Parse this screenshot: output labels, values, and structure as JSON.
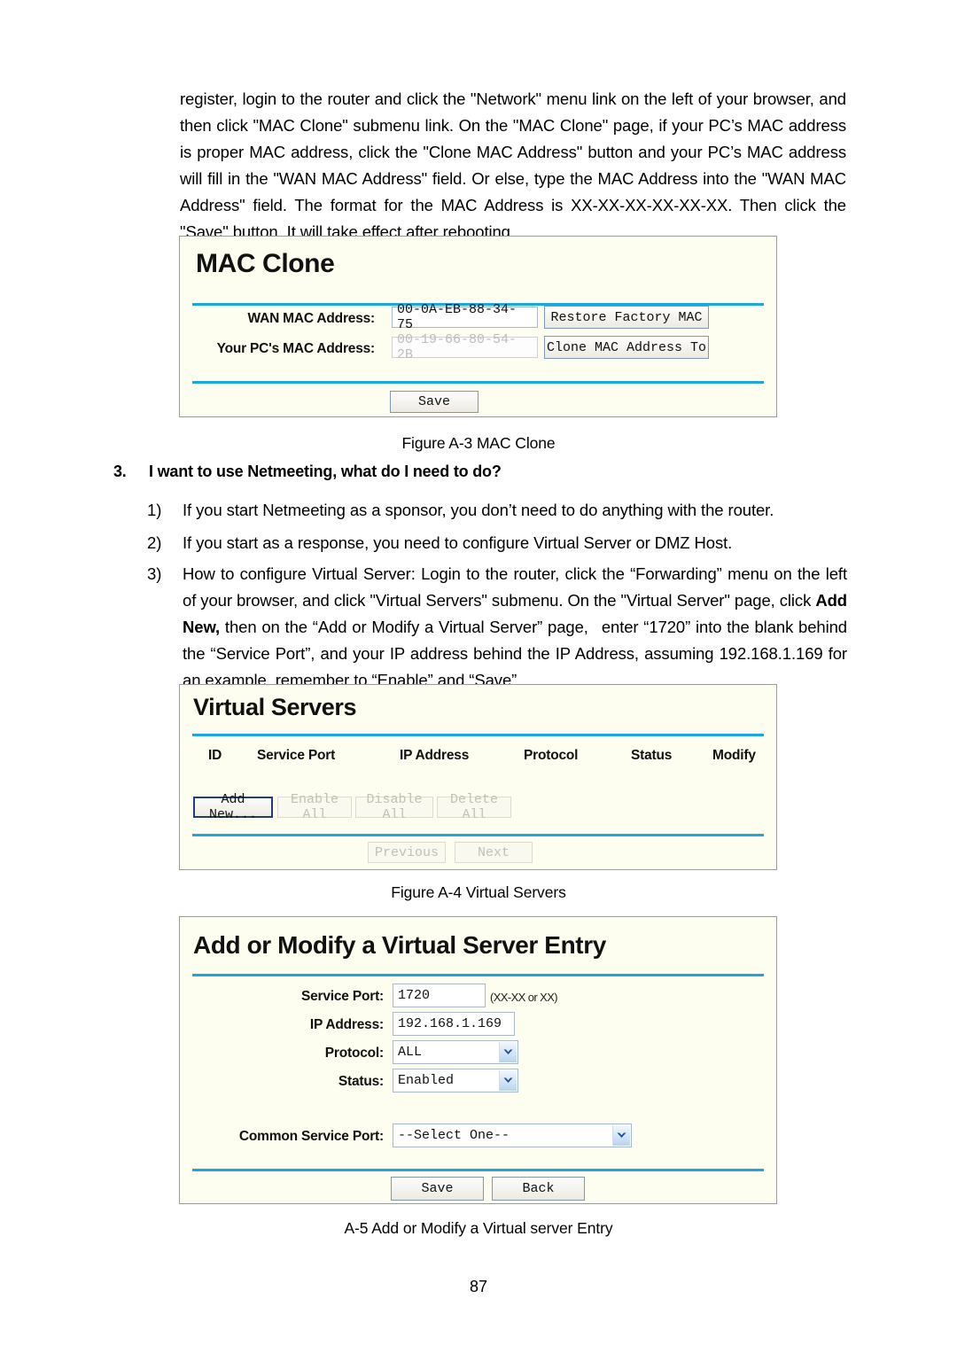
{
  "document": {
    "intro_paragraph": "register, login to the router and click the \"Network\" menu link on the left of your browser, and then click \"MAC Clone\" submenu link. On the \"MAC Clone\" page, if your PC’s MAC address is proper MAC address, click the \"Clone MAC Address\" button and your PC’s MAC address will fill in the \"WAN MAC Address\" field. Or else, type the MAC Address into the \"WAN MAC Address\" field. The format for the MAC Address is XX-XX-XX-XX-XX-XX. Then click the \"Save\" button. It will take effect after rebooting.",
    "page_number": "87"
  },
  "captions": {
    "figure_a3": "Figure A-3 MAC Clone",
    "figure_a4": "Figure A-4 Virtual Servers",
    "figure_a5": "A-5 Add or Modify a Virtual server Entry"
  },
  "question": {
    "number": "3.",
    "text": "I want to use Netmeeting, what do I need to do?"
  },
  "list_items": [
    {
      "marker": "1)",
      "text": "If you start Netmeeting as a sponsor, you don’t need to do anything with the router."
    },
    {
      "marker": "2)",
      "text": "If you start as a response, you need to configure Virtual Server or DMZ Host."
    },
    {
      "marker": "3)",
      "part1": "How to configure Virtual Server: Login to the router, click the “Forwarding” menu on the left of your browser, and click \"Virtual Servers\" submenu. On the \"Virtual Server\" page, click ",
      "bold": "Add New,",
      "part2": " then on the “Add or Modify a Virtual Server” page,  enter “1720” into the blank behind the “Service Port”, and your IP address behind the IP Address, assuming 192.168.1.169 for an example, remember to “Enable” and “Save”."
    }
  ],
  "mac_clone_panel": {
    "title": "MAC Clone",
    "wan_mac_label": "WAN MAC Address:",
    "wan_mac_value": "00-0A-EB-88-34-75",
    "restore_button": "Restore Factory MAC",
    "pc_mac_label": "Your PC's MAC Address:",
    "pc_mac_value": "00-19-66-80-54-2B",
    "clone_button": "Clone MAC Address To",
    "save_button": "Save"
  },
  "virtual_servers_panel": {
    "title": "Virtual Servers",
    "columns": [
      "ID",
      "Service Port",
      "IP Address",
      "Protocol",
      "Status",
      "Modify"
    ],
    "rows": [],
    "buttons": {
      "add_new": "Add New...",
      "enable_all": "Enable All",
      "disable_all": "Disable All",
      "delete_all": "Delete All",
      "previous": "Previous",
      "next": "Next"
    }
  },
  "add_modify_panel": {
    "title": "Add or Modify a Virtual Server Entry",
    "service_port_label": "Service Port:",
    "service_port_value": "1720",
    "service_port_hint": "(XX-XX or XX)",
    "ip_address_label": "IP Address:",
    "ip_address_value": "192.168.1.169",
    "protocol_label": "Protocol:",
    "protocol_value": "ALL",
    "status_label": "Status:",
    "status_value": "Enabled",
    "common_service_port_label": "Common Service Port:",
    "common_service_port_value": "--Select One--",
    "save_button": "Save",
    "back_button": "Back"
  },
  "colors": {
    "panel_bg": "#fdfdf0",
    "divider_cyan": "#1ba7e0",
    "panel_border": "#9a9a9a"
  }
}
